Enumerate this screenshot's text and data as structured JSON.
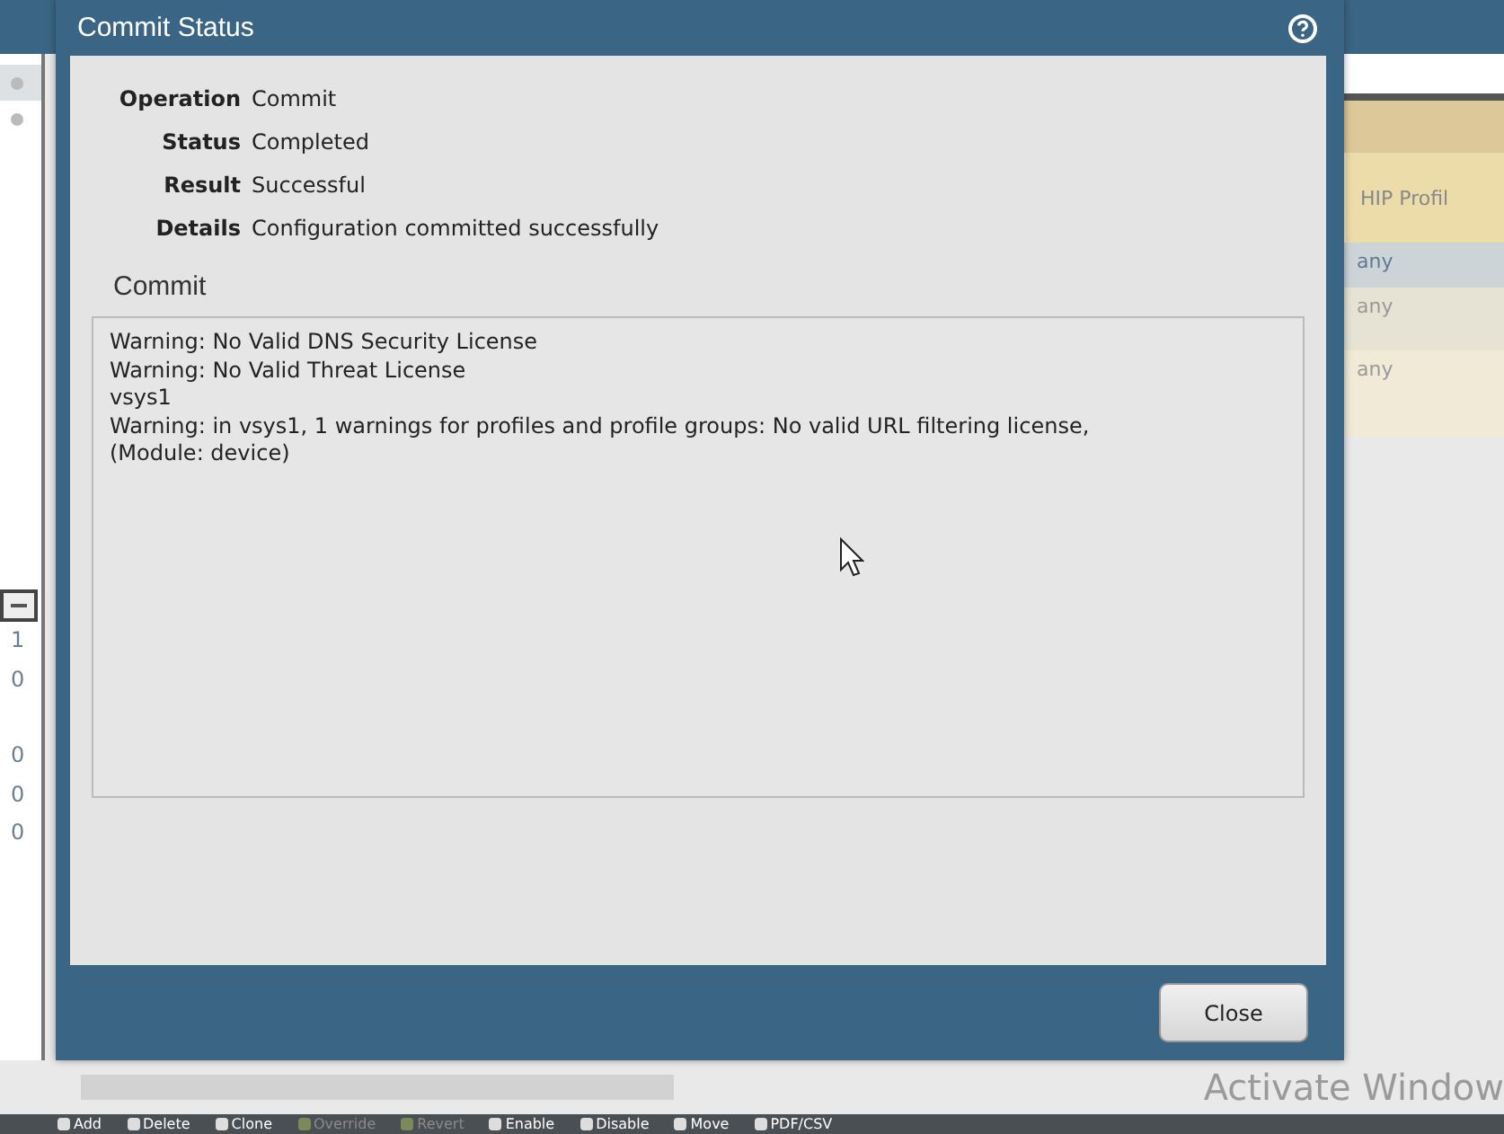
{
  "background": {
    "left_values": [
      "1",
      "0",
      "0",
      "0",
      "0"
    ],
    "table_header": "HIP Profil",
    "table_rows": [
      {
        "cell": "any",
        "selected": true
      },
      {
        "cell": "any",
        "selected": false
      },
      {
        "cell": "any",
        "selected": false
      }
    ]
  },
  "dialog": {
    "title": "Commit Status",
    "fields": [
      {
        "label": "Operation",
        "value": "Commit"
      },
      {
        "label": "Status",
        "value": "Completed"
      },
      {
        "label": "Result",
        "value": "Successful"
      },
      {
        "label": "Details",
        "value": "Configuration committed successfully"
      }
    ],
    "section_title": "Commit",
    "log_lines": [
      "Warning: No Valid DNS Security License",
      "Warning: No Valid Threat License",
      "vsys1",
      "Warning: in vsys1, 1 warnings for profiles and profile groups: No valid URL filtering license,",
      "(Module: device)"
    ],
    "close_button": "Close"
  },
  "os_overlay": "Activate Window",
  "toolbar": [
    {
      "label": "Add",
      "disabled": false
    },
    {
      "label": "Delete",
      "disabled": false
    },
    {
      "label": "Clone",
      "disabled": false
    },
    {
      "label": "Override",
      "disabled": true
    },
    {
      "label": "Revert",
      "disabled": true
    },
    {
      "label": "Enable",
      "disabled": false
    },
    {
      "label": "Disable",
      "disabled": false
    },
    {
      "label": "Move",
      "disabled": false
    },
    {
      "label": "PDF/CSV",
      "disabled": false
    }
  ]
}
